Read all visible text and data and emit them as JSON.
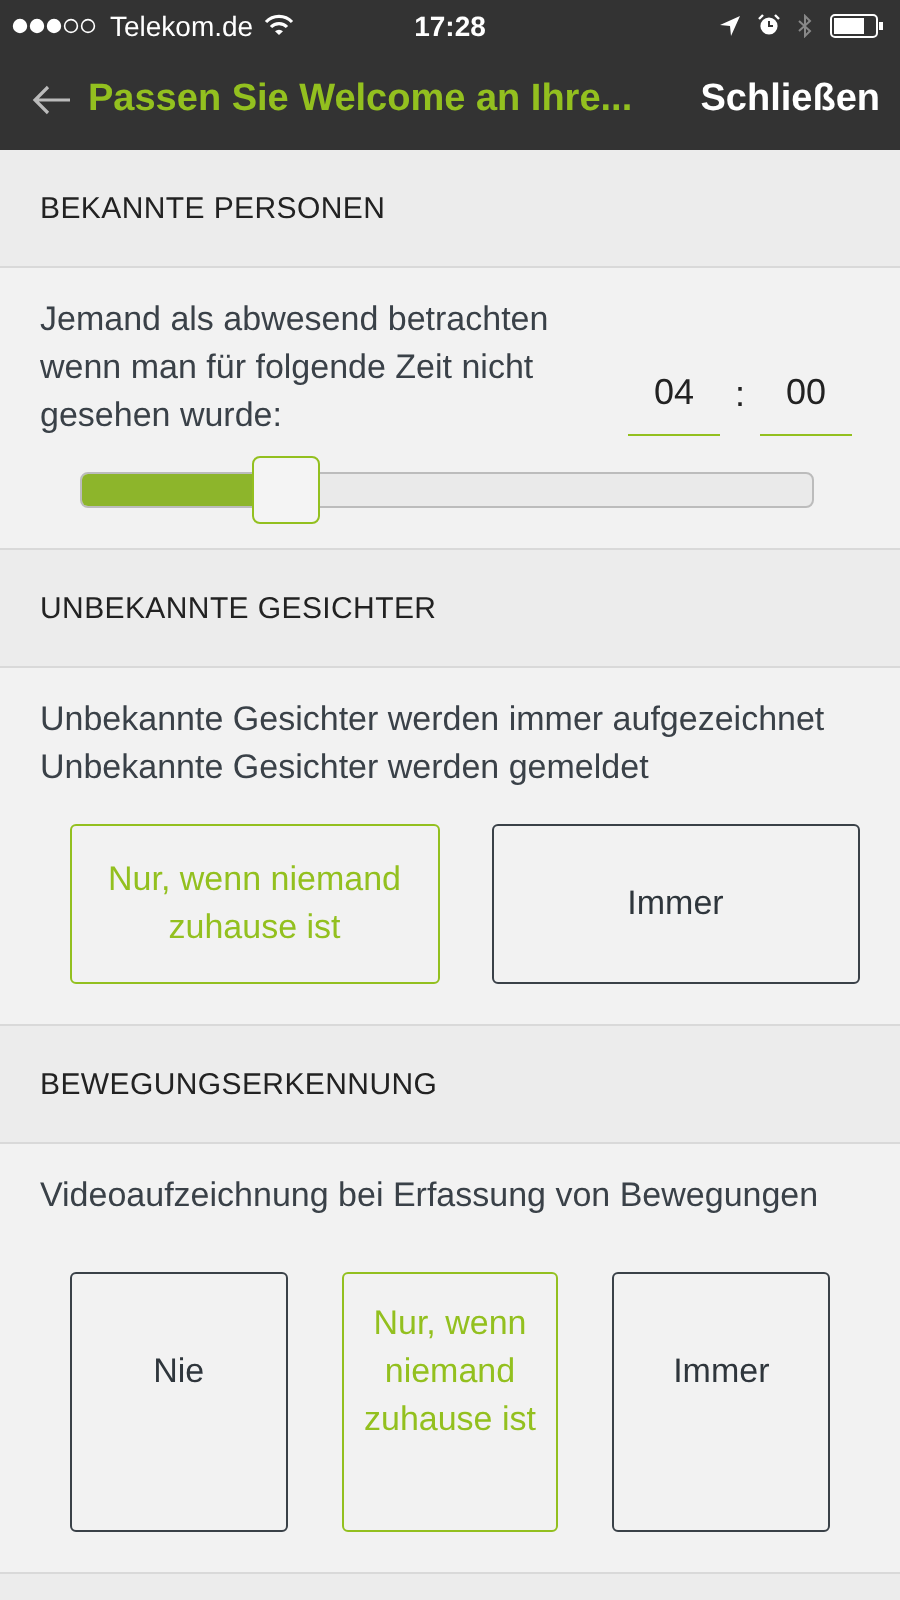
{
  "status_bar": {
    "carrier": "Telekom.de",
    "time": "17:28"
  },
  "nav": {
    "title": "Passen Sie Welcome an Ihre...",
    "close": "Schließen"
  },
  "sections": [
    {
      "header": "BEKANNTE PERSONEN",
      "kind": "slider",
      "text": "Jemand als abwesend betrachten wenn man für folgende Zeit nicht gesehen wurde:",
      "hours": "04",
      "separator": ":",
      "minutes": "00",
      "level": 0.28
    },
    {
      "header": "UNBEKANNTE GESICHTER",
      "kind": "choice",
      "texts": [
        "Unbekannte Gesichter werden immer aufgezeichnet",
        "Unbekannte Gesichter werden gemeldet"
      ],
      "options": [
        {
          "label": "Nur, wenn niemand zuhause ist",
          "selected": true
        },
        {
          "label": "Immer",
          "selected": false
        }
      ]
    },
    {
      "header": "BEWEGUNGSERKENNUNG",
      "kind": "choice",
      "texts": [
        "Videoaufzeichnung bei Erfassung von Bewegungen"
      ],
      "options": [
        {
          "label": "Nie",
          "selected": false
        },
        {
          "label": "Nur, wenn niemand zuhause ist",
          "selected": true
        },
        {
          "label": "Immer",
          "selected": false
        }
      ]
    }
  ]
}
